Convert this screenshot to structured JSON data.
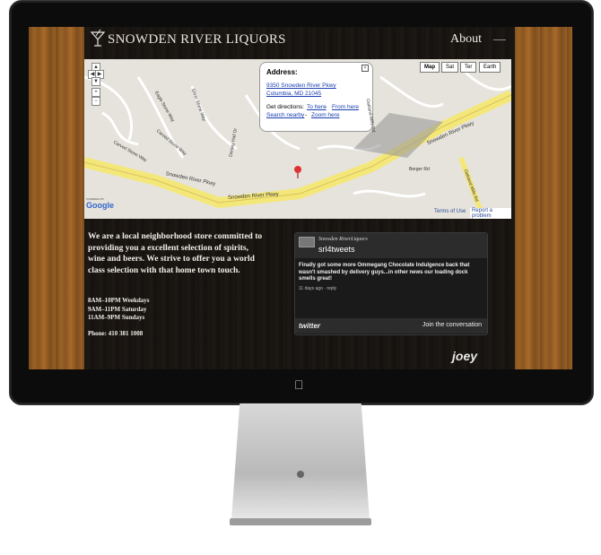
{
  "site": {
    "title": "Snowden River Liquors",
    "nav_about": "About"
  },
  "map": {
    "types": [
      "Map",
      "Sat",
      "Ter",
      "Earth"
    ],
    "active_type": "Map",
    "bubble": {
      "title": "Address:",
      "address_line1": "9350 Snowden River Pkwy",
      "address_line2": "Columbia, MD 21045",
      "directions_label": "Get directions:",
      "to_here": "To here",
      "separator1": " - ",
      "from_here": "From here",
      "search_nearby": "Search nearby",
      "separator2": " - ",
      "zoom_here": "Zoom here"
    },
    "powered_by": "POWERED BY",
    "google": "Google",
    "terms": "Terms of Use",
    "report": "Report a problem",
    "road_labels": [
      "Snowden River Pkwy",
      "Snowden River Pkwy",
      "Snowden River Pkwy",
      "Berger Rd",
      "Oakland Mills Rd",
      "Carved Stone Way",
      "Eagle Stone Way",
      "Carved Stone Way",
      "Silver Stone Way",
      "Oakland Mills Rd",
      "Dorsey Hall Dr"
    ]
  },
  "content": {
    "intro": "We are a local neighborhood store committed to providing you a excellent selection of spirits, wine and beers. We strive to offer you a world class selection with that home town touch.",
    "hours": [
      "8AM–10PM Weekdays",
      "9AM–11PM Saturday",
      "11AM–9PM Sundays"
    ],
    "phone": "Phone: 410 381 1008"
  },
  "twitter": {
    "display_name": "Snowden RiverLiquors",
    "handle": "srl4tweets",
    "tweet": "Finally got some more Ommegang Chocolate Indulgence back that wasn't smashed by delivery guys...in other news our loading dock smells great!",
    "meta": "11 days ago · reply",
    "logo": "twitter",
    "join": "Join the conversation"
  },
  "credit": "joey"
}
